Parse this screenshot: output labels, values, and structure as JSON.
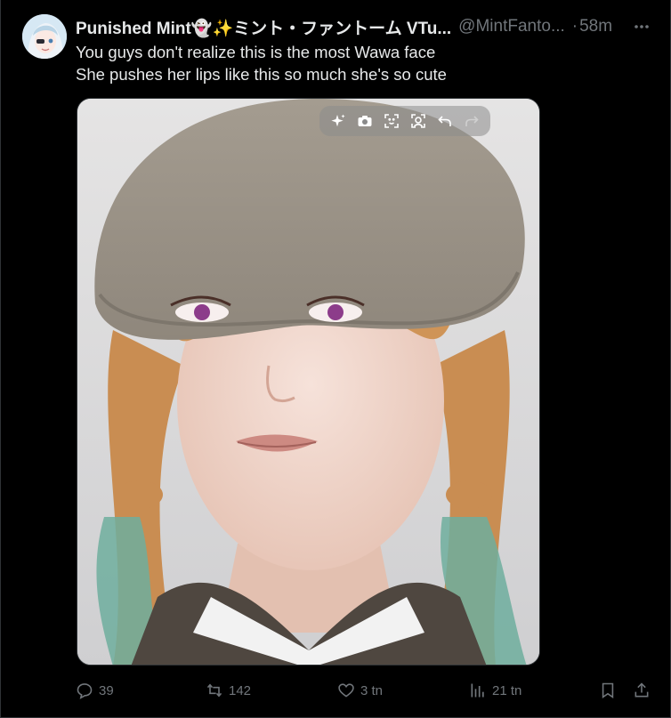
{
  "author": {
    "display_name": "Punished Mint👻✨ミント・ファントーム VTu...",
    "handle": "@MintFanto...",
    "separator": "·",
    "time": "58m"
  },
  "tweet": {
    "lines": [
      "You guys don't realize this is the most Wawa face",
      "She pushes her lips like this so much she's so cute"
    ]
  },
  "media_toolbar": {
    "icons": [
      "sparkle-icon",
      "camera-icon",
      "focus-icon",
      "face-scan-icon",
      "undo-icon",
      "redo-icon"
    ]
  },
  "actions": {
    "replies": "39",
    "reposts": "142",
    "likes": "3 tn",
    "views": "21 tn"
  },
  "colors": {
    "background": "#000000",
    "text": "#e7e9ea",
    "muted": "#71767b",
    "border": "#2f3336"
  }
}
